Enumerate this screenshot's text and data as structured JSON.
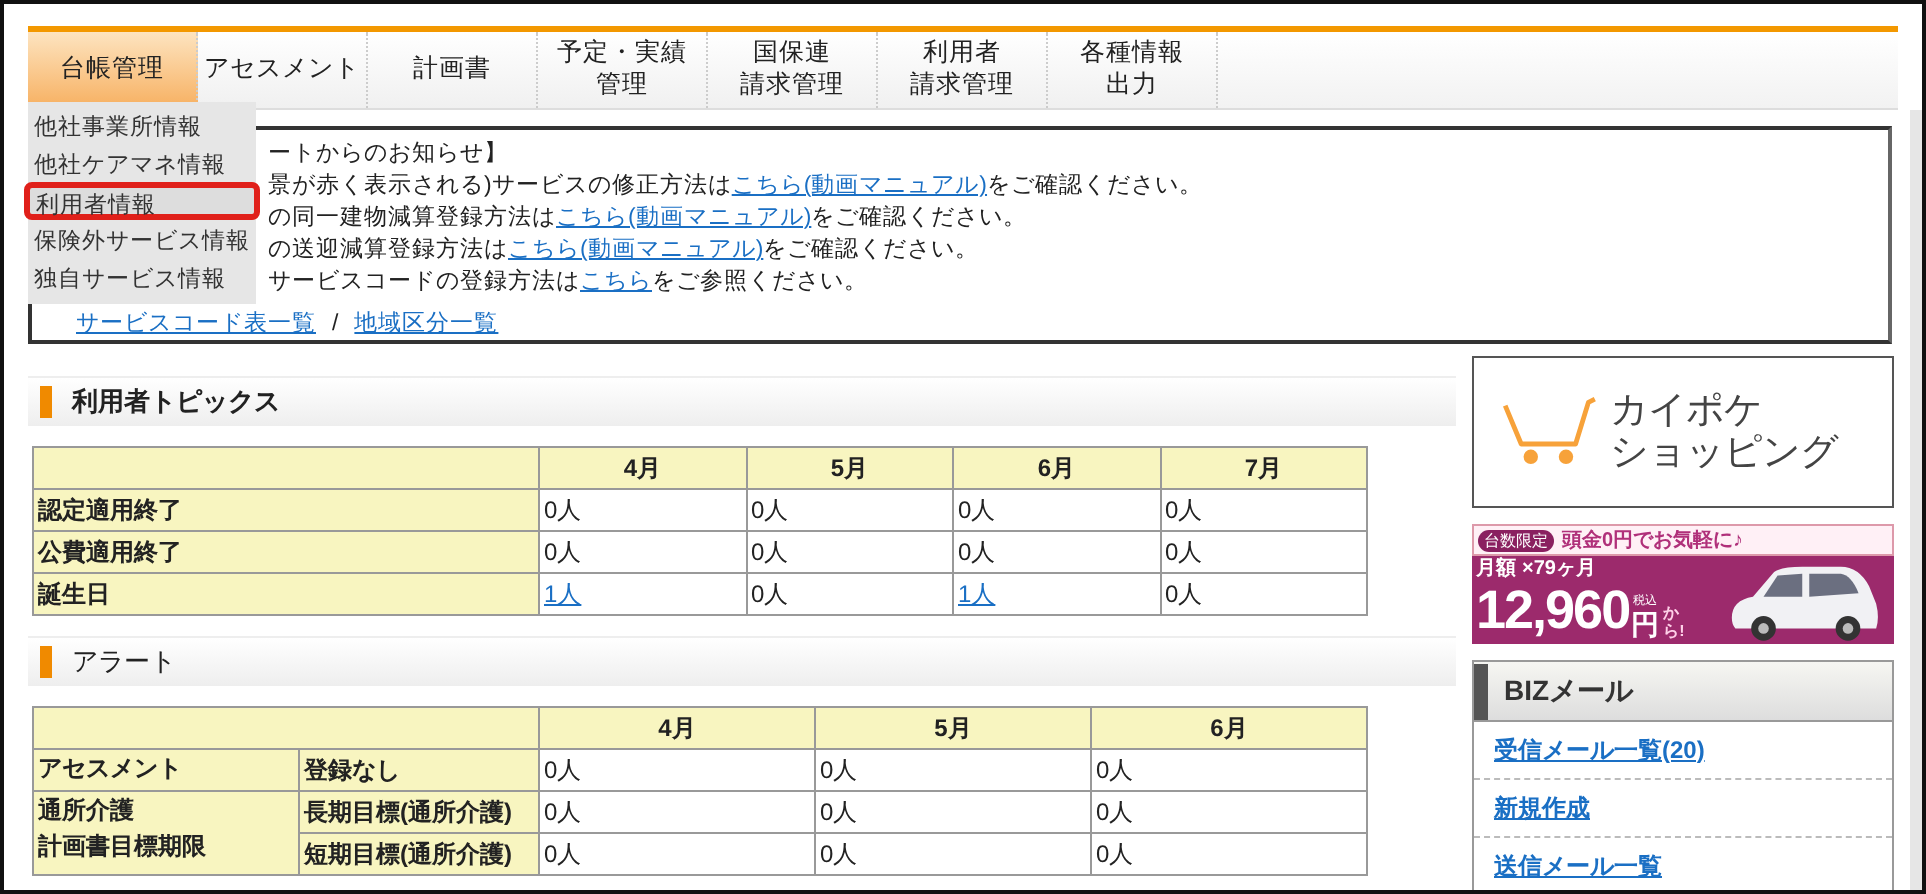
{
  "nav": {
    "tabs": [
      {
        "lines": [
          "台帳管理"
        ],
        "selected": true
      },
      {
        "lines": [
          "アセスメント"
        ],
        "selected": false
      },
      {
        "lines": [
          "計画書"
        ],
        "selected": false
      },
      {
        "lines": [
          "予定・実績",
          "管理"
        ],
        "selected": false
      },
      {
        "lines": [
          "国保連",
          "請求管理"
        ],
        "selected": false
      },
      {
        "lines": [
          "利用者",
          "請求管理"
        ],
        "selected": false
      },
      {
        "lines": [
          "各種情報",
          "出力"
        ],
        "selected": false
      }
    ]
  },
  "dropdown": {
    "items": [
      {
        "label": "他社事業所情報",
        "highlighted": false
      },
      {
        "label": "他社ケアマネ情報",
        "highlighted": false
      },
      {
        "label": "利用者情報",
        "highlighted": true
      },
      {
        "label": "保険外サービス情報",
        "highlighted": false
      },
      {
        "label": "独自サービス情報",
        "highlighted": false
      }
    ]
  },
  "notice": {
    "lines": [
      [
        {
          "text": "ートからのお知らせ】",
          "kind": "text"
        }
      ],
      [
        {
          "text": "景が赤く表示される)サービスの修正方法は",
          "kind": "text"
        },
        {
          "text": "こちら(動画マニュアル)",
          "kind": "link"
        },
        {
          "text": "をご確認ください。",
          "kind": "text"
        }
      ],
      [
        {
          "text": "の同一建物減算登録方法は",
          "kind": "text"
        },
        {
          "text": "こちら(動画マニュアル)",
          "kind": "link"
        },
        {
          "text": "をご確認ください。",
          "kind": "text"
        }
      ],
      [
        {
          "text": "の送迎減算登録方法は",
          "kind": "text"
        },
        {
          "text": "こちら(動画マニュアル)",
          "kind": "link"
        },
        {
          "text": "をご確認ください。",
          "kind": "text"
        }
      ],
      [
        {
          "text": "サービスコードの登録方法は",
          "kind": "text"
        },
        {
          "text": "こちら",
          "kind": "link"
        },
        {
          "text": "をご参照ください。",
          "kind": "text"
        }
      ]
    ],
    "links": [
      "サービスコード表一覧",
      "/",
      "地域区分一覧"
    ]
  },
  "topics": {
    "title": "利用者トピックス",
    "columns": [
      "4月",
      "5月",
      "6月",
      "7月"
    ],
    "rows": [
      {
        "label": "認定適用終了",
        "cells": [
          {
            "text": "0人",
            "kind": "text"
          },
          {
            "text": "0人",
            "kind": "text"
          },
          {
            "text": "0人",
            "kind": "text"
          },
          {
            "text": "0人",
            "kind": "text"
          }
        ]
      },
      {
        "label": "公費適用終了",
        "cells": [
          {
            "text": "0人",
            "kind": "text"
          },
          {
            "text": "0人",
            "kind": "text"
          },
          {
            "text": "0人",
            "kind": "text"
          },
          {
            "text": "0人",
            "kind": "text"
          }
        ]
      },
      {
        "label": "誕生日",
        "cells": [
          {
            "text": "1人",
            "kind": "link"
          },
          {
            "text": "0人",
            "kind": "text"
          },
          {
            "text": "1人",
            "kind": "link"
          },
          {
            "text": "0人",
            "kind": "text"
          }
        ]
      }
    ]
  },
  "alerts": {
    "title": "アラート",
    "columns": [
      "4月",
      "5月",
      "6月"
    ],
    "groups": [
      {
        "lines": [
          "アセスメント"
        ],
        "rows": [
          {
            "label": "登録なし",
            "cells": [
              "0人",
              "0人",
              "0人"
            ]
          }
        ]
      },
      {
        "lines": [
          "通所介護",
          "計画書目標期限"
        ],
        "rows": [
          {
            "label": "長期目標(通所介護)",
            "cells": [
              "0人",
              "0人",
              "0人"
            ]
          },
          {
            "label": "短期目標(通所介護)",
            "cells": [
              "0人",
              "0人",
              "0人"
            ]
          }
        ]
      }
    ]
  },
  "sidebar": {
    "shop": {
      "lines": [
        "カイポケ",
        "ショッピング"
      ]
    },
    "banner": {
      "badge": "台数限定",
      "headline": "頭金0円でお気軽に♪",
      "monthly": "月額",
      "term": "×79ヶ月",
      "price": "12,960",
      "unit": "円",
      "tax": "税込",
      "suffix": "から!"
    },
    "mail": {
      "title": "BIZメール",
      "links": [
        "受信メール一覧(20)",
        "新規作成",
        "送信メール一覧"
      ]
    }
  }
}
